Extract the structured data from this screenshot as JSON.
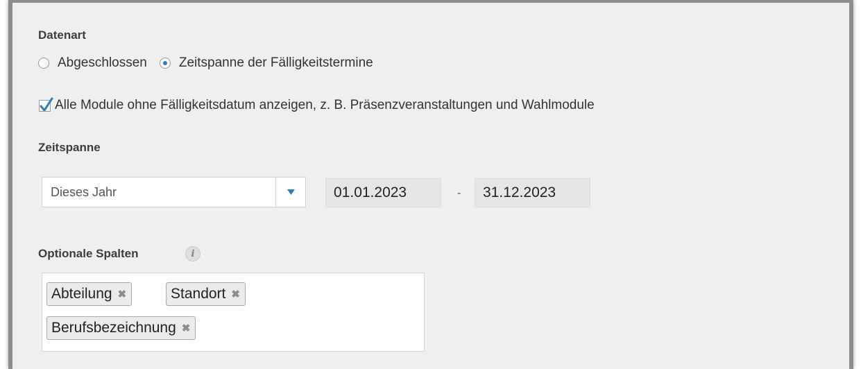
{
  "datenart": {
    "title": "Datenart",
    "options": [
      {
        "label": "Abgeschlossen",
        "selected": false
      },
      {
        "label": "Zeitspanne der Fälligkeitstermine",
        "selected": true
      }
    ],
    "checkbox": {
      "label": "Alle Module ohne Fälligkeitsdatum anzeigen, z. B. Präsenzveranstaltungen und Wahlmodule",
      "checked": true
    }
  },
  "zeitspanne": {
    "title": "Zeitspanne",
    "preset": "Dieses Jahr",
    "start_date": "01.01.2023",
    "separator": "-",
    "end_date": "31.12.2023"
  },
  "optional_columns": {
    "title": "Optionale Spalten",
    "info_icon": "i",
    "tags": [
      {
        "label": "Abteilung",
        "remove": "✖"
      },
      {
        "label": "Standort",
        "remove": "✖"
      },
      {
        "label": "Berufsbezeichnung",
        "remove": "✖"
      }
    ]
  },
  "colors": {
    "accent": "#2e7fb8",
    "panel_bg": "#efefef",
    "frame": "#8d8d8d"
  }
}
